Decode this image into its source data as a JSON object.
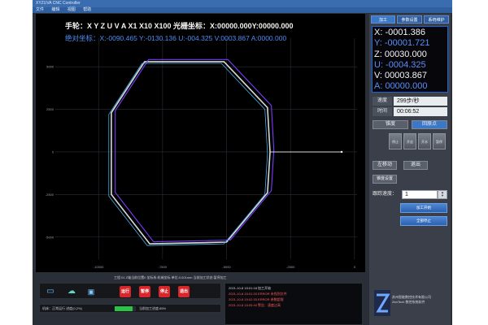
{
  "window": {
    "title": "XYZUVA CNC Controller",
    "menu": [
      "文件",
      "编辑",
      "视图",
      "帮助"
    ]
  },
  "overlay": {
    "hand_wheel": "手轮：X Y Z U V A X1 X10 X100 光栅坐标：X:00000.000Y:00000.000",
    "absolute_coords": "绝对坐标：X:-0090.465 Y:-0130.136 U:-004.325 V:0003.867 A:0000.000"
  },
  "plot": {
    "y_ticks": [
      "5000",
      "2500",
      "0",
      "-2500",
      "-5000"
    ],
    "x_ticks": [
      "-10000",
      "-7500",
      "-5000",
      "-2500",
      "0"
    ],
    "status_line": "工程:01  Z轴当前位置0  坐标系:机械坐标  单位:0.001mm  当前加工状态:暂停加工"
  },
  "side": {
    "tabs": [
      "加工",
      "参数设置",
      "系统维护"
    ],
    "coords": [
      {
        "label": "X: -0001.386",
        "color": "white"
      },
      {
        "label": "Y: -00001.721",
        "color": "blue"
      },
      {
        "label": "Z: 00030.000",
        "color": "white"
      },
      {
        "label": "U: -0004.325",
        "color": "blue"
      },
      {
        "label": "V: 00003.867",
        "color": "white"
      },
      {
        "label": "A: 00000.000",
        "color": "blue"
      }
    ],
    "speed_label": "速度",
    "speed_value": "299步/秒",
    "time_label": "时间",
    "time_value": "00:06:52",
    "toggle_left": "锥度",
    "toggle_right": "回原点",
    "square_buttons": [
      "开丝",
      "开水",
      "暂停",
      "停止"
    ],
    "move_left": "左移动",
    "move_right": "退出",
    "ratio_button": "锥度设置",
    "speed_set_label": "跟踪速度：",
    "speed_set_value": "1",
    "btn_process": "加工开始",
    "btn_stop": "全部停止",
    "company_name": "苏州智能数控技术有限公司",
    "company_sub": "ZenTech 数控系统软件"
  },
  "bottom": {
    "tool_labels": [
      "打开",
      "仿真",
      "存储",
      "运行",
      "暂停",
      "停止",
      "退出"
    ],
    "status": "机床：正常运行    进度(0,2%)",
    "progress": 0.85,
    "progress_label": "当前加工进度:85%",
    "log": [
      "2021-10-8 15:01:18 加工开始",
      "2021-10-8 15:01:20 ERROR 未找到文件",
      "2021-10-8 15:02:33 ERROR 参数超限",
      "2021-10-8 15:05:40 警告：速度过高"
    ]
  },
  "chart_data": {
    "type": "line",
    "series": [
      {
        "values": [
          [
            -9500,
            2300
          ],
          [
            -8200,
            5300
          ],
          [
            -5100,
            5300
          ],
          [
            -3400,
            2600
          ],
          [
            -3300,
            1000
          ],
          [
            -2600,
            0
          ],
          [
            -500,
            0
          ],
          [
            -3300,
            0
          ],
          [
            -3400,
            -2400
          ],
          [
            -5000,
            -5300
          ],
          [
            -8000,
            -5400
          ],
          [
            -9500,
            -2500
          ],
          [
            -9500,
            2300
          ]
        ]
      }
    ],
    "xlim": [
      -11500,
      100
    ],
    "ylim": [
      -6300,
      6200
    ],
    "colors": [
      "#d9d9d9",
      "#7a3dfc",
      "#46b3e6"
    ],
    "grid": true
  }
}
